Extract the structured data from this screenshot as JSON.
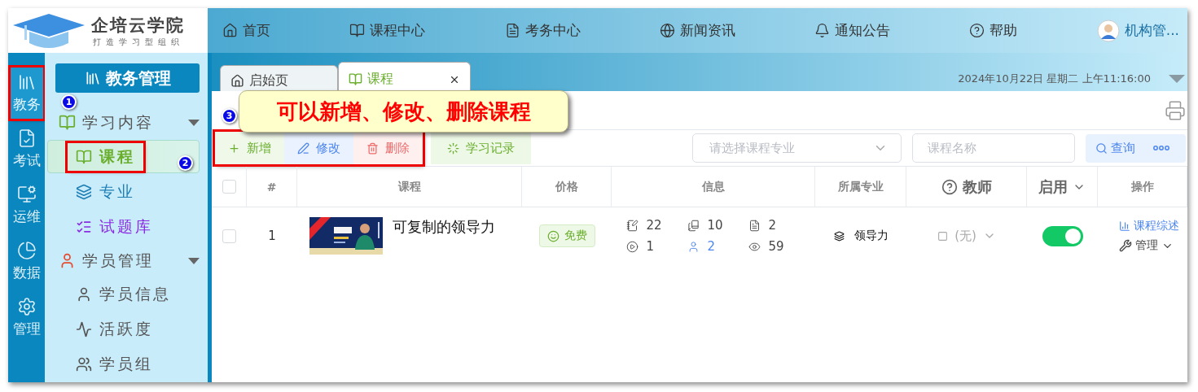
{
  "logo": {
    "name": "企培云学院",
    "slogan": "打造学习型组织"
  },
  "top_nav": [
    {
      "label": "首页"
    },
    {
      "label": "课程中心"
    },
    {
      "label": "考务中心"
    },
    {
      "label": "新闻资讯"
    },
    {
      "label": "通知公告"
    },
    {
      "label": "帮助"
    }
  ],
  "user": {
    "name": "机构管..."
  },
  "rail": [
    {
      "label": "教务",
      "selected": true,
      "highlighted": true
    },
    {
      "label": "考试",
      "selected": false,
      "highlighted": false
    },
    {
      "label": "运维",
      "selected": false,
      "highlighted": false
    },
    {
      "label": "数据",
      "selected": false,
      "highlighted": false
    },
    {
      "label": "管理",
      "selected": false,
      "highlighted": false
    }
  ],
  "sidebar": {
    "header": "教务管理",
    "groups": [
      {
        "label": "学习内容",
        "expanded": true,
        "children": [
          {
            "label": "课程",
            "selected": true,
            "highlighted": true,
            "color": "#6aae2e"
          },
          {
            "label": "专业",
            "selected": false,
            "highlighted": false,
            "color": "#1f7fb5"
          },
          {
            "label": "试题库",
            "selected": false,
            "highlighted": false,
            "color": "#8a2be2"
          }
        ]
      },
      {
        "label": "学员管理",
        "expanded": true,
        "children": [
          {
            "label": "学员信息",
            "selected": false,
            "highlighted": false,
            "color": "#555555"
          },
          {
            "label": "活跃度",
            "selected": false,
            "highlighted": false,
            "color": "#555555"
          },
          {
            "label": "学员组",
            "selected": false,
            "highlighted": false,
            "color": "#555555"
          }
        ]
      }
    ]
  },
  "tabs": [
    {
      "label": "启始页",
      "selected": false
    },
    {
      "label": "课程",
      "selected": true
    }
  ],
  "datetime": "2024年10月22日 星期二 上午11:16:00",
  "toolbar": {
    "highlighted": true,
    "buttons": [
      {
        "label": "新增",
        "kind": "add"
      },
      {
        "label": "修改",
        "kind": "edit"
      },
      {
        "label": "删除",
        "kind": "delete"
      },
      {
        "label": "学习记录",
        "kind": "record"
      }
    ],
    "major_select": {
      "placeholder": "请选择课程专业"
    },
    "name_field": {
      "placeholder": "课程名称"
    },
    "search_button": "查询"
  },
  "table": {
    "header_checked": false,
    "columns": [
      {
        "label": "#",
        "kind": "plain"
      },
      {
        "label": "课程",
        "kind": "plain"
      },
      {
        "label": "价格",
        "kind": "plain"
      },
      {
        "label": "信息",
        "kind": "plain"
      },
      {
        "label": "所属专业",
        "kind": "plain"
      },
      {
        "label": "教师",
        "kind": "help"
      },
      {
        "label": "启用",
        "kind": "filter"
      },
      {
        "label": "操作",
        "kind": "plain"
      }
    ],
    "rows": [
      {
        "checked": false,
        "index": "1",
        "thumbnail": {
          "kind": "picture"
        },
        "title": "可复制的领导力",
        "price": "免费",
        "stats": [
          {
            "value": "22",
            "kind": "plain"
          },
          {
            "value": "10",
            "kind": "plain"
          },
          {
            "value": "2",
            "kind": "plain"
          },
          {
            "value": "1",
            "kind": "plain"
          },
          {
            "value": "2",
            "kind": "link"
          },
          {
            "value": "59",
            "kind": "plain"
          }
        ],
        "major": "领导力",
        "teacher": "(无)",
        "enabled": true,
        "actions": [
          {
            "label": "课程综述",
            "kind": "link"
          },
          {
            "label": "管理",
            "kind": "menu"
          }
        ]
      }
    ]
  },
  "annotations": {
    "markers": [
      {
        "label": "1"
      },
      {
        "label": "2"
      },
      {
        "label": "3"
      }
    ],
    "callout": "可以新增、修改、删除课程"
  }
}
